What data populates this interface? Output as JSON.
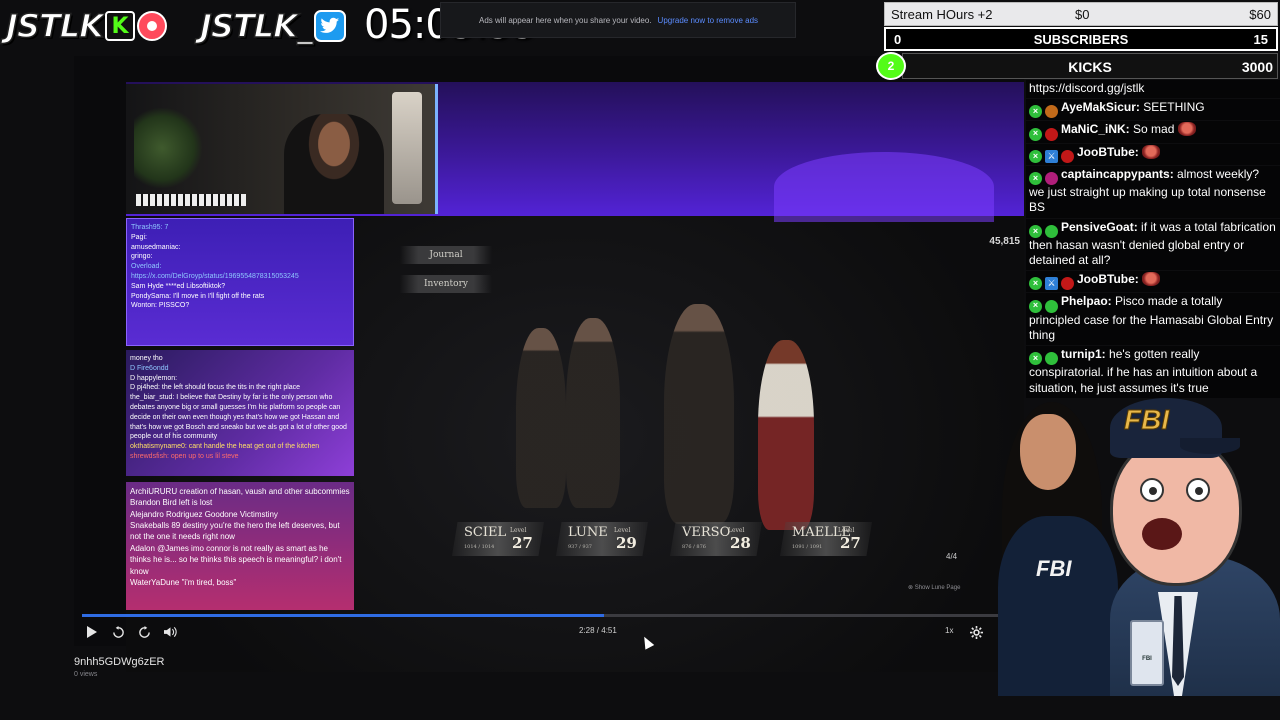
{
  "branding": {
    "name_1": "JSTLK",
    "kick_letter": "K",
    "name_2": "JSTLK_"
  },
  "clock": "05:03:35",
  "ad": {
    "text": "Ads will appear here when you share your video.",
    "link": "Upgrade now to remove ads"
  },
  "stats": {
    "stream_hours_label": "Stream HOurs +2",
    "stream_hours_start": "$0",
    "stream_hours_end": "$60",
    "subscribers_current": "0",
    "subscribers_label": "SUBSCRIBERS",
    "subscribers_goal": "15",
    "kicks_current": "2",
    "kicks_label": "KICKS",
    "kicks_goal": "3000"
  },
  "chat": [
    {
      "user": "",
      "text": "https://discord.gg/jstlk"
    },
    {
      "user": "AyeMakSicur:",
      "text": "SEETHING"
    },
    {
      "user": "MaNiC_iNK:",
      "text": "So mad"
    },
    {
      "user": "JooBTube:",
      "text": ""
    },
    {
      "user": "captaincappypants:",
      "text": "almost weekly? we just straight up making up total nonsense BS"
    },
    {
      "user": "PensiveGoat:",
      "text": "if it was a total fabrication then hasan wasn't denied global entry or detained at all?"
    },
    {
      "user": "JooBTube:",
      "text": ""
    },
    {
      "user": "Phelpao:",
      "text": "Pisco made a totally principled case for the Hamasabi Global Entry thing"
    },
    {
      "user": "turnip1:",
      "text": "he's gotten really conspiratorial. if he has an intuition about a situation, he just assumes it's true"
    }
  ],
  "video": {
    "overlay_chat_1": [
      "Thrash95: 7",
      "Pagi:",
      "amusedmaniac:",
      "gringo:",
      "Overload:",
      "https://x.com/DelGroyp/status/1969554878315053245",
      "Sam Hyde ****ed Libsoftiktok?",
      "PondySama: I'll move in I'll fight off the rats",
      "Wonton: PISSCO?"
    ],
    "overlay_chat_2": [
      "money tho",
      "D Fire6ondd",
      "D happylemon:",
      "D pj4hed: the left should focus the tits in the right place",
      "the_biar_stud: I believe that Destiny by far is the only person who debates anyone big or small guesses I'm his platform so people can decide on their own even though yes that's how we got Hassan and that's how we got Bosch and sneako but we als got a lot of other good people out of his community",
      "okthatismyname0: cant handle the heat get out of the kitchen",
      "shrewdsfish: open up to us lil steve"
    ],
    "overlay_chat_3": [
      "ArchiURURU creation of hasan, vaush and other subcommies",
      "Brandon Bird left is lost",
      "Alejandro Rodriguez Goodone Victimstiny",
      "Snakeballs 89 destiny you're the hero the left deserves, but not the one it needs right now",
      "Adalon @James imo connor is not really as smart as he thinks he is... so he thinks this speech is meaningful? i don't know",
      "WaterYaDune \"i'm tired, boss\""
    ],
    "game": {
      "journal": "Journal",
      "inventory": "Inventory",
      "score": "45,815",
      "characters": [
        {
          "name": "SCIEL",
          "hp": "1014 / 1014",
          "level_label": "Level",
          "level": "27"
        },
        {
          "name": "LUNE",
          "hp": "937 / 937",
          "level_label": "Level",
          "level": "29"
        },
        {
          "name": "VERSO",
          "hp": "876 / 876",
          "level_label": "Level",
          "level": "28"
        },
        {
          "name": "MAELLE",
          "hp": "1091 / 1091",
          "level_label": "Level",
          "level": "27"
        }
      ],
      "hint_1": "Show Lune Page",
      "counter": "4/4"
    },
    "progress": 0.558,
    "time": "2:28 / 4:51",
    "speed": "1x",
    "title": "9nhh5GDWg6zER",
    "views": "0 views"
  },
  "avatars": {
    "woman_badge": "FBI",
    "man_cap": "FBI",
    "man_badge": "FBI"
  },
  "colors": {
    "kick_green": "#53fc18",
    "twitter_blue": "#1d9bf0",
    "progress_blue": "#2f6ce4"
  }
}
